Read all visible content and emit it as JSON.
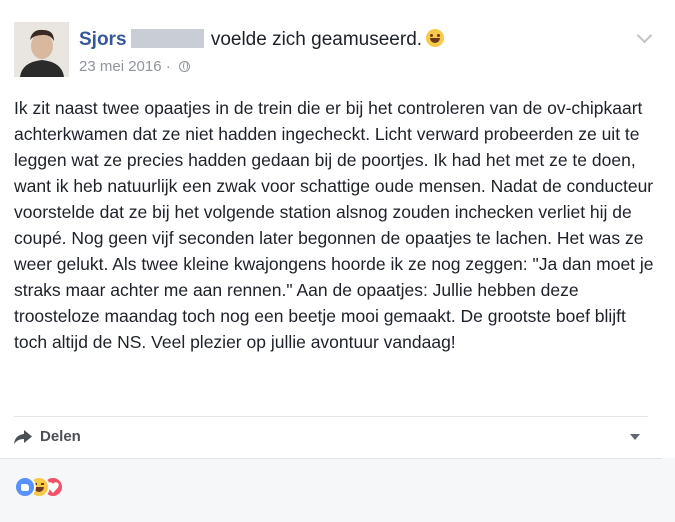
{
  "post": {
    "author": "Sjors",
    "action": "voelde zich geamuseerd.",
    "feeling_icon": "grinning-face-icon",
    "date": "23 mei 2016",
    "separator": "·",
    "audience_icon": "globe-icon",
    "text": "Ik zit naast twee opaatjes in de trein die er bij het controleren van de ov-chipkaart achterkwamen dat ze niet hadden ingecheckt. Licht verward probeerden ze uit te leggen wat ze precies hadden gedaan bij de poortjes. Ik had het met ze te doen, want ik heb natuurlijk een zwak voor schattige oude mensen. Nadat de conducteur voorstelde dat ze bij het volgende station alsnog zouden inchecken verliet hij de coupé. Nog geen vijf seconden later begonnen de opaatjes te lachen. Het was ze weer gelukt. Als twee kleine kwajongens hoorde ik ze nog zeggen: \"Ja dan moet je straks maar achter me aan rennen.\" Aan de opaatjes: Jullie hebben deze troosteloze maandag toch nog een beetje mooi gemaakt. De grootste boef blijft toch altijd de NS. Veel plezier op jullie avontuur vandaag!"
  },
  "actions": {
    "share_label": "Delen",
    "share_icon": "share-arrow-icon",
    "menu_icon": "caret-down-icon"
  },
  "reactions": {
    "icons": [
      "like-icon",
      "haha-icon",
      "love-icon"
    ]
  },
  "colors": {
    "author_link": "#365899",
    "meta_text": "#90949c",
    "like": "#5890ff",
    "haha": "#f7c948",
    "love": "#f25268",
    "footer_bg": "#f6f7f9"
  }
}
